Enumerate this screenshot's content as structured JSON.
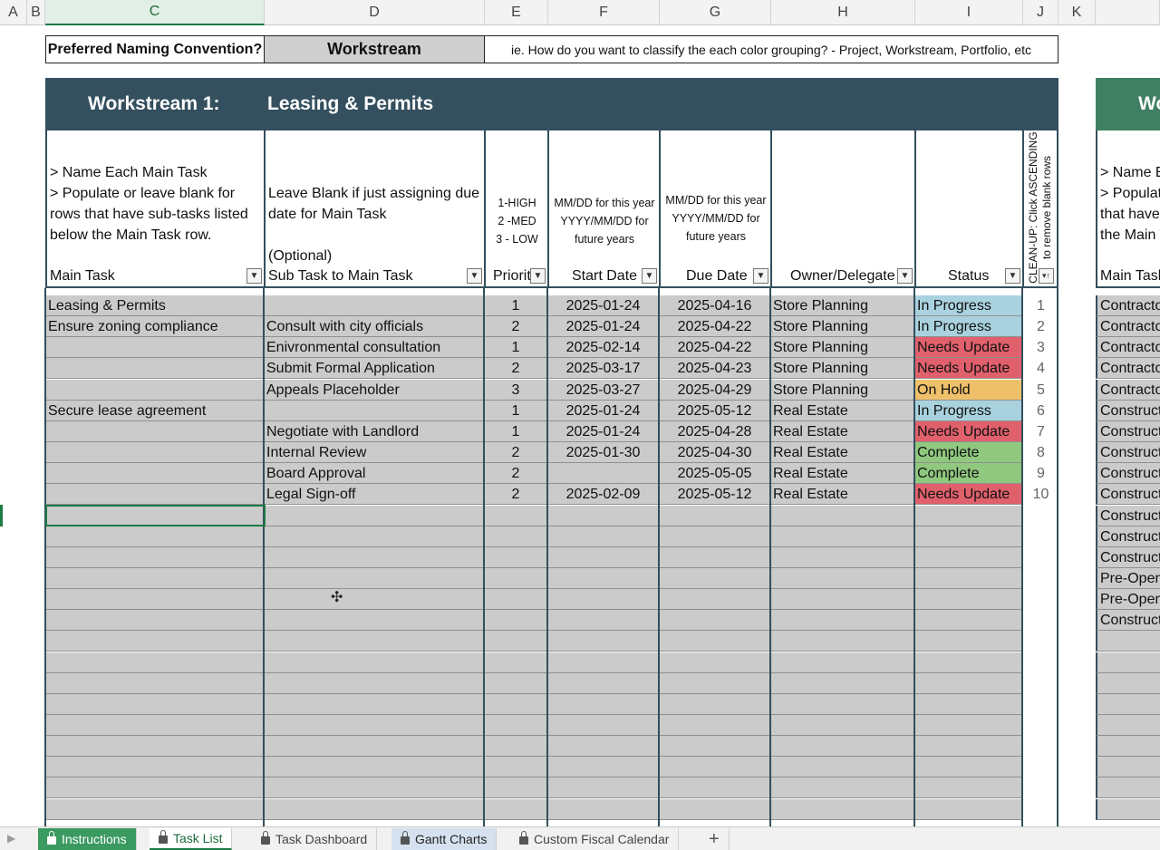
{
  "columns": [
    "A",
    "B",
    "C",
    "D",
    "E",
    "F",
    "G",
    "H",
    "I",
    "J",
    "K"
  ],
  "naming": {
    "label": "Preferred Naming Convention?",
    "value": "Workstream",
    "hint": "ie. How do you want to classify the each color grouping? - Project, Workstream, Portfolio, etc"
  },
  "workstream": {
    "number_label": "Workstream 1:",
    "name": "Leasing & Permits",
    "next_label": "Wo"
  },
  "headers": {
    "main_task_note": "> Name Each Main Task\n> Populate or leave blank for rows that have sub-tasks listed below the Main Task row.",
    "main_task": "Main Task",
    "sub_task_note": "Leave Blank if just assigning due date for Main Task\n\n(Optional)",
    "sub_task": "Sub Task to Main Task",
    "priority_note": "1-HIGH\n2 -MED\n3 - LOW",
    "priority": "Priorit",
    "start_note": "MM/DD for this year\nYYYY/MM/DD for future years",
    "start_date": "Start Date",
    "due_note": "MM/DD for this year\nYYYY/MM/DD for future years",
    "due_date": "Due Date",
    "owner": "Owner/Delegate",
    "status": "Status",
    "cleanup_note": "CLEAN-UP: Click ASCENDING to remove blank rows",
    "next_main_task_note": "> Name E\n> Populate\nthat have\nthe Main T",
    "next_main_task": "Main Task"
  },
  "status_colors": {
    "In Progress": "#a9d2de",
    "Needs Update": "#e0606c",
    "On Hold": "#efc06a",
    "Complete": "#8fc87e"
  },
  "tasks": [
    {
      "main": "Leasing & Permits",
      "sub": "",
      "priority": "1",
      "start": "2025-01-24",
      "due": "2025-04-16",
      "owner": "Store Planning",
      "status": "In Progress",
      "num": "1"
    },
    {
      "main": "Ensure zoning compliance",
      "sub": "Consult with city officials",
      "priority": "2",
      "start": "2025-01-24",
      "due": "2025-04-22",
      "owner": "Store Planning",
      "status": "In Progress",
      "num": "2"
    },
    {
      "main": "",
      "sub": "Enivronmental consultation",
      "priority": "1",
      "start": "2025-02-14",
      "due": "2025-04-22",
      "owner": "Store Planning",
      "status": "Needs Update",
      "num": "3"
    },
    {
      "main": "",
      "sub": "Submit Formal Application",
      "priority": "2",
      "start": "2025-03-17",
      "due": "2025-04-23",
      "owner": "Store Planning",
      "status": "Needs Update",
      "num": "4"
    },
    {
      "main": "",
      "sub": "Appeals Placeholder",
      "priority": "3",
      "start": "2025-03-27",
      "due": "2025-04-29",
      "owner": "Store Planning",
      "status": "On Hold",
      "num": "5"
    },
    {
      "main": "Secure lease agreement",
      "sub": "",
      "priority": "1",
      "start": "2025-01-24",
      "due": "2025-05-12",
      "owner": "Real Estate",
      "status": "In Progress",
      "num": "6"
    },
    {
      "main": "",
      "sub": "Negotiate with Landlord",
      "priority": "1",
      "start": "2025-01-24",
      "due": "2025-04-28",
      "owner": "Real Estate",
      "status": "Needs Update",
      "num": "7"
    },
    {
      "main": "",
      "sub": "Internal Review",
      "priority": "2",
      "start": "2025-01-30",
      "due": "2025-04-30",
      "owner": "Real Estate",
      "status": "Complete",
      "num": "8"
    },
    {
      "main": "",
      "sub": "Board Approval",
      "priority": "2",
      "start": "",
      "due": "2025-05-05",
      "owner": "Real Estate",
      "status": "Complete",
      "num": "9"
    },
    {
      "main": "",
      "sub": "Legal Sign-off",
      "priority": "2",
      "start": "2025-02-09",
      "due": "2025-05-12",
      "owner": "Real Estate",
      "status": "Needs Update",
      "num": "10"
    }
  ],
  "blank_rows": 15,
  "next_panel_tasks": [
    "Contracto",
    "Contracto",
    "Contracto",
    "Contracto",
    "Contracto",
    "Construct",
    "Construct",
    "Construct",
    "Construct",
    "Construct",
    "Construct",
    "Construct",
    "Construct",
    "Pre-Open",
    "Pre-Open",
    "Construct"
  ],
  "tabs": [
    {
      "label": "Instructions",
      "style": "green",
      "locked": true
    },
    {
      "label": "Task List",
      "style": "active",
      "locked": true
    },
    {
      "label": "Task Dashboard",
      "style": "plain",
      "locked": true
    },
    {
      "label": "Gantt Charts",
      "style": "blue",
      "locked": true
    },
    {
      "label": "Custom Fiscal Calendar",
      "style": "plain",
      "locked": true
    }
  ],
  "add_sheet_label": "+"
}
